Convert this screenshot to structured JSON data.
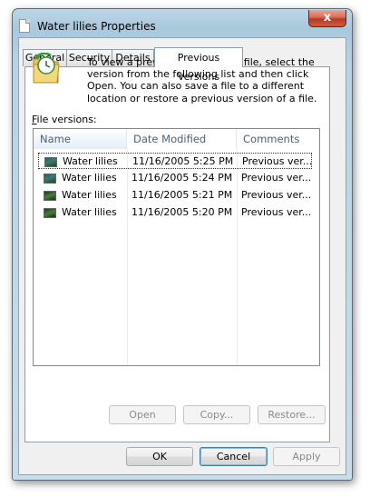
{
  "window": {
    "title": "Water lilies Properties",
    "close_glyph": "x"
  },
  "tabs": [
    {
      "label": "General"
    },
    {
      "label": "Security"
    },
    {
      "label": "Details"
    },
    {
      "label": "Previous Versions",
      "active": true
    }
  ],
  "previous_versions": {
    "icon": "previous-versions-icon",
    "intro": "To view a previous version of a file, select the version from the following list and then click Open.  You can also save a file to a different location or restore a previous version of a file.",
    "file_versions_label_accel": "F",
    "file_versions_label_rest": "ile versions:",
    "columns": [
      "Name",
      "Date Modified",
      "Comments"
    ],
    "rows": [
      {
        "name": "Water lilies",
        "date_modified": "11/16/2005 5:25 PM",
        "comments": "Previous ver..."
      },
      {
        "name": "Water lilies",
        "date_modified": "11/16/2005 5:24 PM",
        "comments": "Previous ver..."
      },
      {
        "name": "Water lilies",
        "date_modified": "11/16/2005 5:21 PM",
        "comments": "Previous ver..."
      },
      {
        "name": "Water lilies",
        "date_modified": "11/16/2005 5:20 PM",
        "comments": "Previous ver..."
      }
    ],
    "buttons": {
      "open": "Open",
      "copy": "Copy...",
      "restore": "Restore..."
    }
  },
  "dialog_buttons": {
    "ok": "OK",
    "cancel": "Cancel",
    "apply": "Apply"
  }
}
